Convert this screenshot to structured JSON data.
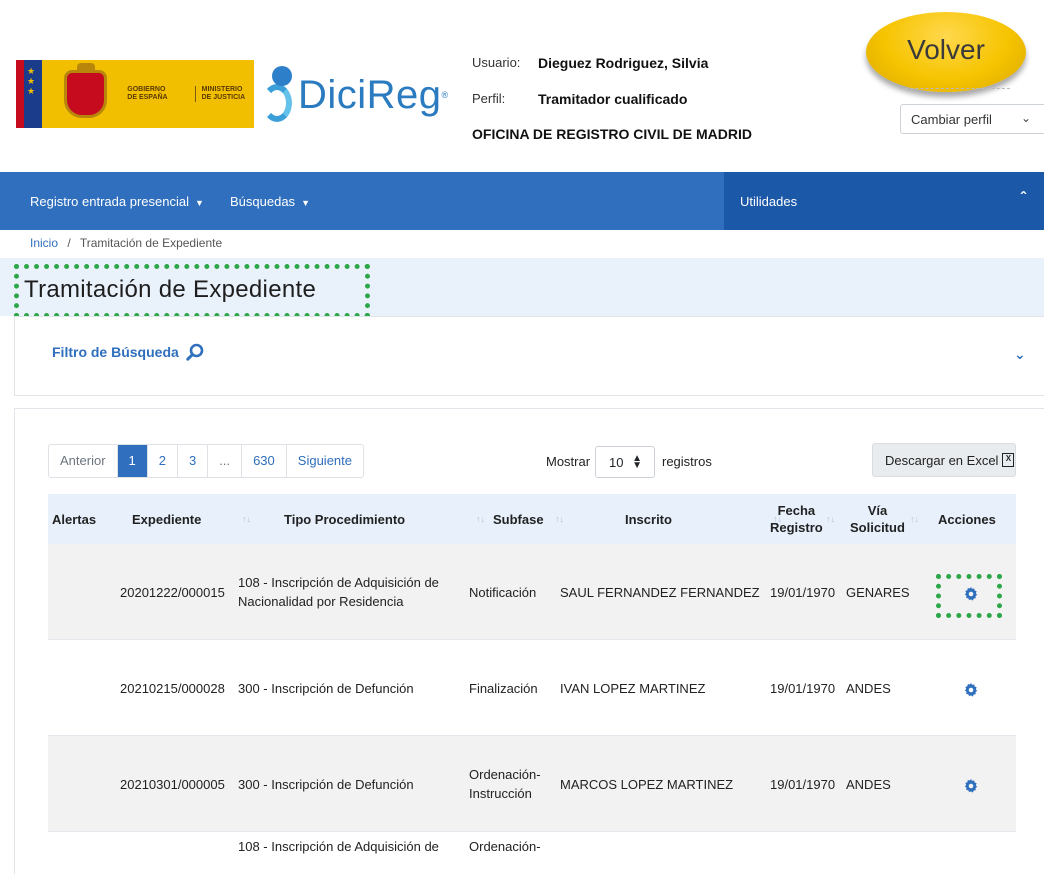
{
  "header": {
    "gov_logo": {
      "line1": "GOBIERNO",
      "line2": "DE ESPAÑA",
      "ministry1": "MINISTERIO",
      "ministry2": "DE JUSTICIA"
    },
    "app_name": "DiciReg",
    "app_sup": "®",
    "user_label": "Usuario:",
    "user_value": "Dieguez Rodriguez, Silvia",
    "profile_label": "Perfil:",
    "profile_value": "Tramitador cualificado",
    "office": "OFICINA DE REGISTRO CIVIL DE MADRID",
    "back_button": "Volver",
    "change_profile": "Cambiar perfil"
  },
  "navbar": {
    "items": [
      {
        "label": "Registro entrada presencial"
      },
      {
        "label": "Búsquedas"
      }
    ],
    "utilities": "Utilidades"
  },
  "breadcrumb": {
    "home": "Inicio",
    "separator": "/",
    "current": "Tramitación de Expediente"
  },
  "page_title": "Tramitación de Expediente",
  "filter": {
    "label": "Filtro de Búsqueda"
  },
  "pagination": {
    "prev": "Anterior",
    "pages": [
      "1",
      "2",
      "3",
      "...",
      "630"
    ],
    "next": "Siguiente",
    "active": "1"
  },
  "page_size": {
    "prefix": "Mostrar",
    "value": "10",
    "suffix": "registros"
  },
  "excel_button": "Descargar en Excel",
  "table": {
    "headers": {
      "alertas": "Alertas",
      "expediente": "Expediente",
      "tipo": "Tipo Procedimiento",
      "subfase": "Subfase",
      "inscrito": "Inscrito",
      "fecha1": "Fecha",
      "fecha2": "Registro",
      "via1": "Vía",
      "via2": "Solicitud",
      "acciones": "Acciones"
    },
    "rows": [
      {
        "expediente": "20201222/000015",
        "tipo": "108 - Inscripción de Adquisición de Nacionalidad por Residencia",
        "subfase": "Notificación",
        "inscrito": "SAUL FERNANDEZ FERNANDEZ",
        "fecha": "19/01/1970",
        "via": "GENARES"
      },
      {
        "expediente": "20210215/000028",
        "tipo": "300 - Inscripción de Defunción",
        "subfase": "Finalización",
        "inscrito": "IVAN LOPEZ MARTINEZ",
        "fecha": "19/01/1970",
        "via": "ANDES"
      },
      {
        "expediente": "20210301/000005",
        "tipo": "300 - Inscripción de Defunción",
        "subfase": "Ordenación-Instrucción",
        "inscrito": "MARCOS LOPEZ MARTINEZ",
        "fecha": "19/01/1970",
        "via": "ANDES"
      },
      {
        "expediente": "",
        "tipo": "108 - Inscripción de Adquisición de",
        "subfase": "Ordenación-",
        "inscrito": "",
        "fecha": "",
        "via": ""
      }
    ]
  },
  "colors": {
    "nav_blue": "#2f6fbd",
    "utilities_blue": "#1b58a8",
    "title_band": "#e9f1fb",
    "highlight_green": "#2ea64a",
    "volver_yellow": "#f6c400"
  },
  "icons": [
    "search-icon",
    "gear-icon",
    "excel-icon",
    "chevron-down-icon",
    "chevron-up-icon",
    "caret-down-icon"
  ]
}
